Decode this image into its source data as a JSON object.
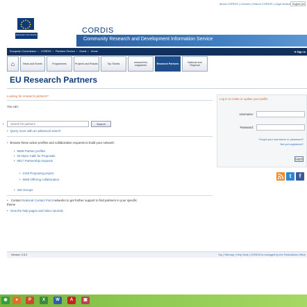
{
  "topbar": {
    "links": "About CORDIS | Contact | Search CORDIS | Legal Notice",
    "language_select": "English (en)"
  },
  "header": {
    "commission_label": "European Commission",
    "site_name": "CORDIS",
    "tagline": "Community Research and Development Information Service"
  },
  "breadcrumb": {
    "items": [
      "European Commission",
      "CORDIS",
      "Partners Service",
      "Guest",
      "Home"
    ],
    "signin": "Sign in"
  },
  "nav": {
    "home_icon": "home-icon",
    "tabs": [
      {
        "label": "News and Events"
      },
      {
        "label": "Programmes"
      },
      {
        "label": "Projects and Results"
      },
      {
        "label": "Top Stories"
      },
      {
        "label": "research*eu magazines"
      },
      {
        "label": "Research Partners",
        "active": true
      },
      {
        "label": "National and Regional"
      }
    ]
  },
  "page": {
    "title": "EU Research Partners"
  },
  "left": {
    "heading": "Looking for research partners?",
    "you_can": "You can:",
    "search_placeholder": "Search for partners",
    "search_button": "Search",
    "advanced_search": "Query more with an advanced search",
    "browse_intro": "Browse these active profiles and collaboration requests to build your network:",
    "browse_items": [
      "9659 Partner profiles",
      "93 Open Calls for Proposals",
      "8817 Partnership requests"
    ],
    "request_types": [
      "2118 Proposing project",
      "6699 Offering collaboration"
    ],
    "groups": "332 Groups",
    "contact_prefix": "Contact",
    "contact_link": "National Contact Point",
    "contact_suffix": "networks to get further support to find partners in your specific theme",
    "help_link": "View the help pages and video tutorials"
  },
  "login": {
    "heading": "Log in to create or update your profile",
    "username_label": "Username:",
    "password_label": "Password:",
    "forgot_line1": "Forgot your username or password?",
    "forgot_line2": "Not yet registered?",
    "login_button": "Log in"
  },
  "social": {
    "icons": [
      {
        "name": "rss-icon",
        "color": "#f08a24"
      },
      {
        "name": "twitter-icon",
        "color": "#2f86d1"
      },
      {
        "name": "facebook-icon",
        "color": "#3b5998"
      }
    ]
  },
  "footer": {
    "version": "Version: 2.5.2",
    "links": "Top | Sitemap | Help Desk | CORDIS is managed by the Publications Office"
  },
  "taskbar": {
    "icons": [
      {
        "name": "start-icon",
        "color": "#2f9e3f"
      },
      {
        "name": "firefox-icon",
        "color": "#e2702c"
      },
      {
        "name": "powerpoint-icon",
        "color": "#d24726"
      },
      {
        "name": "excel-icon",
        "color": "#3c8a3c"
      },
      {
        "name": "word-icon",
        "color": "#2b5fae"
      },
      {
        "name": "acrobat-icon",
        "color": "#c9231d"
      },
      {
        "name": "image-viewer-icon",
        "color": "#c23d56"
      }
    ]
  }
}
